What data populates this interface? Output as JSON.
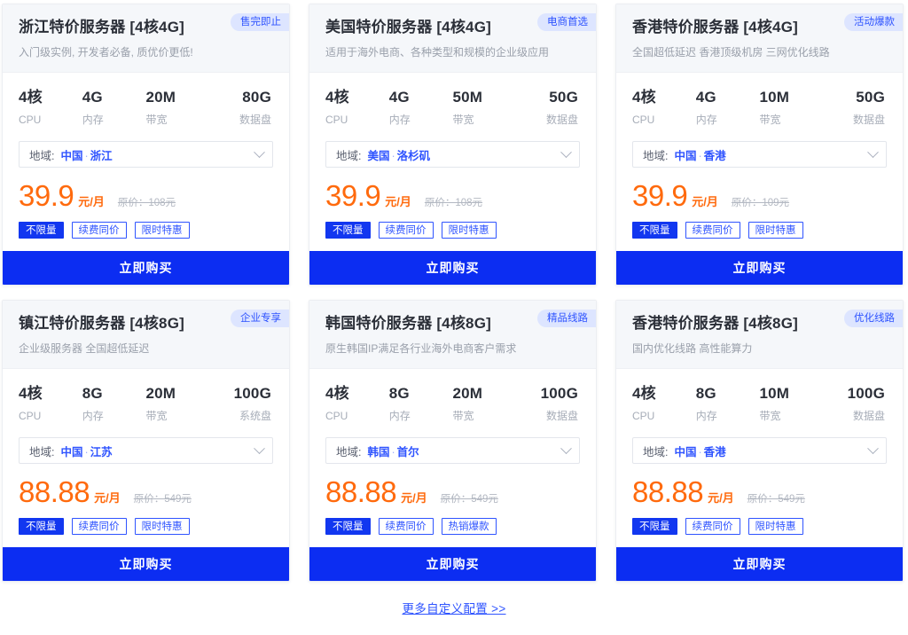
{
  "colors": {
    "accent_blue": "#2f54ff",
    "button_blue": "#0c2df2",
    "price_orange": "#ff6a0d",
    "badge_bg": "#dde5ff",
    "header_bg": "#f5f7fa",
    "muted_text": "#a7adb8"
  },
  "common": {
    "region_label": "地域:",
    "region_separator": "·",
    "price_unit": "元/月",
    "buy_label": "立即购买",
    "chevron_icon": "chevron-down-icon"
  },
  "footer": {
    "more_link": "更多自定义配置 >>"
  },
  "cards": [
    {
      "title": "浙江特价服务器 [4核4G]",
      "subtitle": "入门级实例, 开发者必备, 质优价更低!",
      "badge": "售完即止",
      "specs": [
        {
          "value": "4核",
          "label": "CPU"
        },
        {
          "value": "4G",
          "label": "内存"
        },
        {
          "value": "20M",
          "label": "带宽"
        },
        {
          "value": "80G",
          "label": "数据盘"
        }
      ],
      "region_country": "中国",
      "region_city": "浙江",
      "price": "39.9",
      "original_price": "原价：108元",
      "tags": [
        "不限量",
        "续费同价",
        "限时特惠"
      ],
      "buy_label": "立即购买"
    },
    {
      "title": "美国特价服务器 [4核4G]",
      "subtitle": "适用于海外电商、各种类型和规模的企业级应用",
      "badge": "电商首选",
      "specs": [
        {
          "value": "4核",
          "label": "CPU"
        },
        {
          "value": "4G",
          "label": "内存"
        },
        {
          "value": "50M",
          "label": "带宽"
        },
        {
          "value": "50G",
          "label": "数据盘"
        }
      ],
      "region_country": "美国",
      "region_city": "洛杉矶",
      "price": "39.9",
      "original_price": "原价：108元",
      "tags": [
        "不限量",
        "续费同价",
        "限时特惠"
      ],
      "buy_label": "立即购买"
    },
    {
      "title": "香港特价服务器 [4核4G]",
      "subtitle": "全国超低延迟 香港顶级机房 三网优化线路",
      "badge": "活动爆款",
      "specs": [
        {
          "value": "4核",
          "label": "CPU"
        },
        {
          "value": "4G",
          "label": "内存"
        },
        {
          "value": "10M",
          "label": "带宽"
        },
        {
          "value": "50G",
          "label": "数据盘"
        }
      ],
      "region_country": "中国",
      "region_city": "香港",
      "price": "39.9",
      "original_price": "原价：109元",
      "tags": [
        "不限量",
        "续费同价",
        "限时特惠"
      ],
      "buy_label": "立即购买"
    },
    {
      "title": "镇江特价服务器 [4核8G]",
      "subtitle": "企业级服务器 全国超低延迟",
      "badge": "企业专享",
      "specs": [
        {
          "value": "4核",
          "label": "CPU"
        },
        {
          "value": "8G",
          "label": "内存"
        },
        {
          "value": "20M",
          "label": "带宽"
        },
        {
          "value": "100G",
          "label": "系统盘"
        }
      ],
      "region_country": "中国",
      "region_city": "江苏",
      "price": "88.88",
      "original_price": "原价：549元",
      "tags": [
        "不限量",
        "续费同价",
        "限时特惠"
      ],
      "buy_label": "立即购买"
    },
    {
      "title": "韩国特价服务器 [4核8G]",
      "subtitle": "原生韩国IP满足各行业海外电商客户需求",
      "badge": "精品线路",
      "specs": [
        {
          "value": "4核",
          "label": "CPU"
        },
        {
          "value": "8G",
          "label": "内存"
        },
        {
          "value": "20M",
          "label": "带宽"
        },
        {
          "value": "100G",
          "label": "数据盘"
        }
      ],
      "region_country": "韩国",
      "region_city": "首尔",
      "price": "88.88",
      "original_price": "原价：549元",
      "tags": [
        "不限量",
        "续费同价",
        "热销爆款"
      ],
      "buy_label": "立即购买"
    },
    {
      "title": "香港特价服务器 [4核8G]",
      "subtitle": "国内优化线路 高性能算力",
      "badge": "优化线路",
      "specs": [
        {
          "value": "4核",
          "label": "CPU"
        },
        {
          "value": "8G",
          "label": "内存"
        },
        {
          "value": "10M",
          "label": "带宽"
        },
        {
          "value": "100G",
          "label": "数据盘"
        }
      ],
      "region_country": "中国",
      "region_city": "香港",
      "price": "88.88",
      "original_price": "原价：549元",
      "tags": [
        "不限量",
        "续费同价",
        "限时特惠"
      ],
      "buy_label": "立即购买"
    }
  ]
}
